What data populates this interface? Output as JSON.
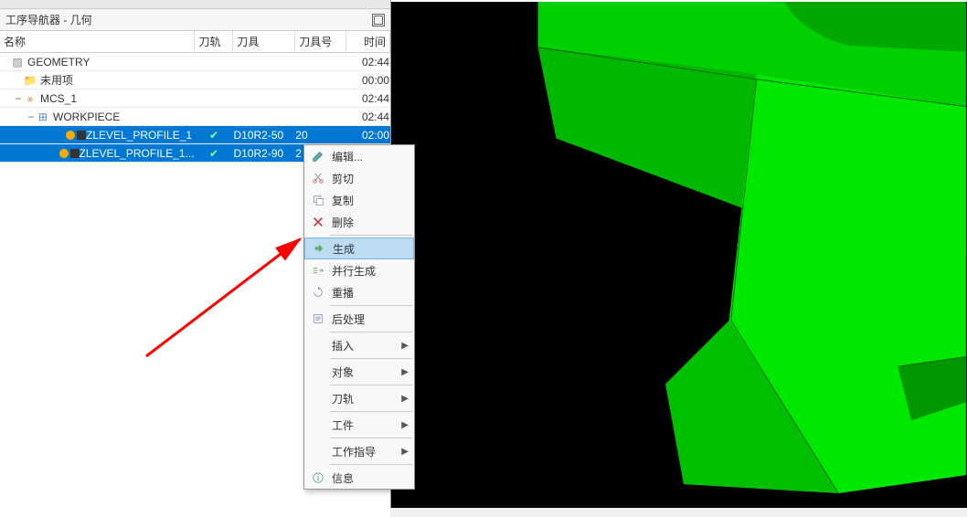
{
  "panel": {
    "title": "工序导航器 - 几何"
  },
  "columns": {
    "name": "名称",
    "track": "刀轨",
    "tool": "刀具",
    "toolnum": "刀具号",
    "time": "时间"
  },
  "tree": [
    {
      "name": "GEOMETRY",
      "indent": 0,
      "time": "02:44",
      "icon": "geom",
      "expander": ""
    },
    {
      "name": "未用项",
      "indent": 1,
      "time": "00:00",
      "icon": "folder",
      "expander": ""
    },
    {
      "name": "MCS_1",
      "indent": 1,
      "time": "02:44",
      "icon": "mcs",
      "expander": "−"
    },
    {
      "name": "WORKPIECE",
      "indent": 2,
      "time": "02:44",
      "icon": "workpiece",
      "expander": "−"
    },
    {
      "name": "ZLEVEL_PROFILE_1",
      "indent": 4,
      "time": "02:00",
      "icon": "op",
      "tool": "D10R2-50",
      "toolnum": "20",
      "track": true,
      "selected": true
    },
    {
      "name": "ZLEVEL_PROFILE_1...",
      "indent": 4,
      "time": "",
      "icon": "op",
      "tool": "D10R2-90",
      "toolnum": "2",
      "track": true,
      "selected": true
    }
  ],
  "contextMenu": {
    "items": [
      {
        "label": "编辑...",
        "icon": "edit",
        "highlighted": false
      },
      {
        "label": "剪切",
        "icon": "cut"
      },
      {
        "label": "复制",
        "icon": "copy"
      },
      {
        "label": "删除",
        "icon": "delete"
      },
      {
        "sep": true
      },
      {
        "label": "生成",
        "icon": "generate",
        "highlighted": true
      },
      {
        "label": "并行生成",
        "icon": "parallel"
      },
      {
        "label": "重播",
        "icon": "replay"
      },
      {
        "sep": true
      },
      {
        "label": "后处理",
        "icon": "postproc"
      },
      {
        "sep": true
      },
      {
        "label": "插入",
        "submenu": true
      },
      {
        "sep": true
      },
      {
        "label": "对象",
        "submenu": true
      },
      {
        "sep": true
      },
      {
        "label": "刀轨",
        "submenu": true
      },
      {
        "sep": true
      },
      {
        "label": "工件",
        "submenu": true
      },
      {
        "sep": true
      },
      {
        "label": "工作指导",
        "submenu": true
      },
      {
        "sep": true
      },
      {
        "label": "信息",
        "icon": "info"
      }
    ]
  }
}
